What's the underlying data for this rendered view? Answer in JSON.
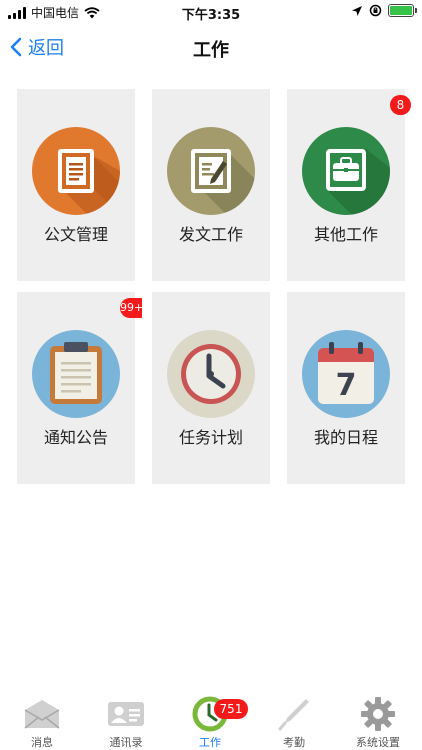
{
  "status_bar": {
    "carrier": "中国电信",
    "time": "下午3:35"
  },
  "nav": {
    "back_label": "返回",
    "title": "工作"
  },
  "tiles": [
    {
      "label": "公文管理",
      "icon": "document-icon",
      "color": "#e0782e",
      "badge": ""
    },
    {
      "label": "发文工作",
      "icon": "edit-document-icon",
      "color": "#a39b6c",
      "badge": ""
    },
    {
      "label": "其他工作",
      "icon": "briefcase-icon",
      "color": "#2e8a48",
      "badge": "8"
    },
    {
      "label": "通知公告",
      "icon": "clipboard-icon",
      "color": "#7ab4d8",
      "badge": "99+"
    },
    {
      "label": "任务计划",
      "icon": "clock-icon",
      "color": "#dcd8c8",
      "badge": ""
    },
    {
      "label": "我的日程",
      "icon": "calendar-icon",
      "color": "#7ab4d8",
      "badge": "",
      "calendar_day": "7"
    }
  ],
  "tab_bar": {
    "tabs": [
      {
        "label": "消息",
        "icon": "envelope-icon"
      },
      {
        "label": "通讯录",
        "icon": "contact-card-icon"
      },
      {
        "label": "工作",
        "icon": "work-clock-icon",
        "badge": "751",
        "active": true
      },
      {
        "label": "考勤",
        "icon": "pen-icon"
      },
      {
        "label": "系统设置",
        "icon": "gear-icon"
      }
    ]
  }
}
